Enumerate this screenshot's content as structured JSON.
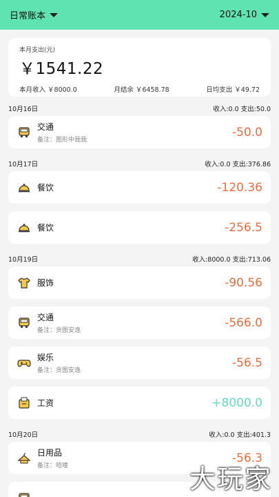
{
  "header": {
    "book": "日常账本",
    "month": "2024-10"
  },
  "summary": {
    "label": "本月支出(元)",
    "amount": "￥1541.22",
    "income": "本月收入 ￥8000.0",
    "balance": "月结余 ￥6458.78",
    "daily": "日均支出 ￥49.72"
  },
  "days": [
    {
      "date": "10月16日",
      "totals": "收入:0.0  支出:50.0",
      "items": [
        {
          "icon": "bus-icon",
          "title": "交通",
          "note": "备注：图形中我我",
          "amount": "-50.0",
          "type": "expense"
        }
      ]
    },
    {
      "date": "10月17日",
      "totals": "收入:0.0  支出:376.86",
      "items": [
        {
          "icon": "food-cloche-icon",
          "title": "餐饮",
          "note": "",
          "amount": "-120.36",
          "type": "expense"
        },
        {
          "icon": "food-cloche-icon",
          "title": "餐饮",
          "note": "",
          "amount": "-256.5",
          "type": "expense"
        }
      ]
    },
    {
      "date": "10月19日",
      "totals": "收入:8000.0  支出:713.06",
      "items": [
        {
          "icon": "tshirt-icon",
          "title": "服饰",
          "note": "",
          "amount": "-90.56",
          "type": "expense"
        },
        {
          "icon": "bus-icon",
          "title": "交通",
          "note": "备注：贪图安逸",
          "amount": "-566.0",
          "type": "expense"
        },
        {
          "icon": "gamepad-icon",
          "title": "娱乐",
          "note": "备注：贪图安逸",
          "amount": "-56.5",
          "type": "expense"
        },
        {
          "icon": "wallet-icon",
          "title": "工资",
          "note": "",
          "amount": "+8000.0",
          "type": "income"
        }
      ]
    },
    {
      "date": "10月20日",
      "totals": "收入:0.0  支出:401.3",
      "items": [
        {
          "icon": "hanger-icon",
          "title": "日用品",
          "note": "备注：哈喽",
          "amount": "-56.3",
          "type": "expense"
        },
        {
          "icon": "bus-icon",
          "title": "",
          "note": "",
          "amount": "",
          "type": "expense"
        }
      ]
    }
  ],
  "watermark": "大玩家",
  "colors": {
    "accent": "#5fe3b0",
    "expense": "#ee6b3a",
    "income": "#63ddb9",
    "icon_fill": "#f7c948"
  }
}
